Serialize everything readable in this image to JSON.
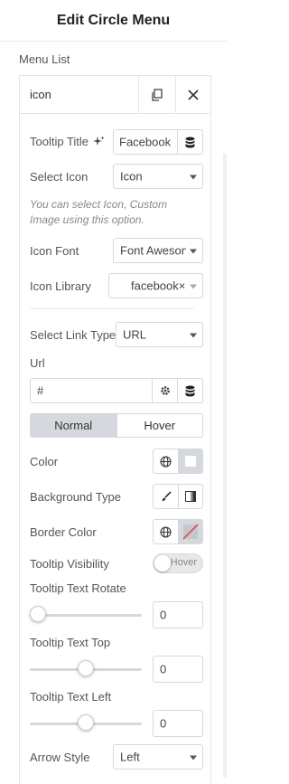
{
  "header": {
    "title": "Edit Circle Menu"
  },
  "section": {
    "label": "Menu List"
  },
  "repeater": {
    "item_title": "icon"
  },
  "fields": {
    "tooltip_title": {
      "label": "Tooltip Title",
      "value": "Facebook"
    },
    "select_icon": {
      "label": "Select Icon",
      "value": "Icon"
    },
    "hint": "You can select Icon, Custom Image using this option.",
    "icon_font": {
      "label": "Icon Font",
      "value": "Font Aweson"
    },
    "icon_library": {
      "label": "Icon Library",
      "value": "facebook×"
    },
    "link_type": {
      "label": "Select Link Type",
      "value": "URL"
    },
    "url": {
      "label": "Url",
      "value": "#"
    },
    "tabs": {
      "normal": "Normal",
      "hover": "Hover"
    },
    "color": {
      "label": "Color"
    },
    "background_type": {
      "label": "Background Type"
    },
    "border_color": {
      "label": "Border Color"
    },
    "tooltip_visibility": {
      "label": "Tooltip Visibility",
      "toggle_text": "Hover"
    },
    "text_rotate": {
      "label": "Tooltip Text Rotate",
      "value": "0",
      "level": 0
    },
    "text_top": {
      "label": "Tooltip Text Top",
      "value": "0",
      "level": 0.5
    },
    "text_left": {
      "label": "Tooltip Text Left",
      "value": "0",
      "level": 0.5
    },
    "arrow_style": {
      "label": "Arrow Style",
      "value": "Left"
    }
  }
}
